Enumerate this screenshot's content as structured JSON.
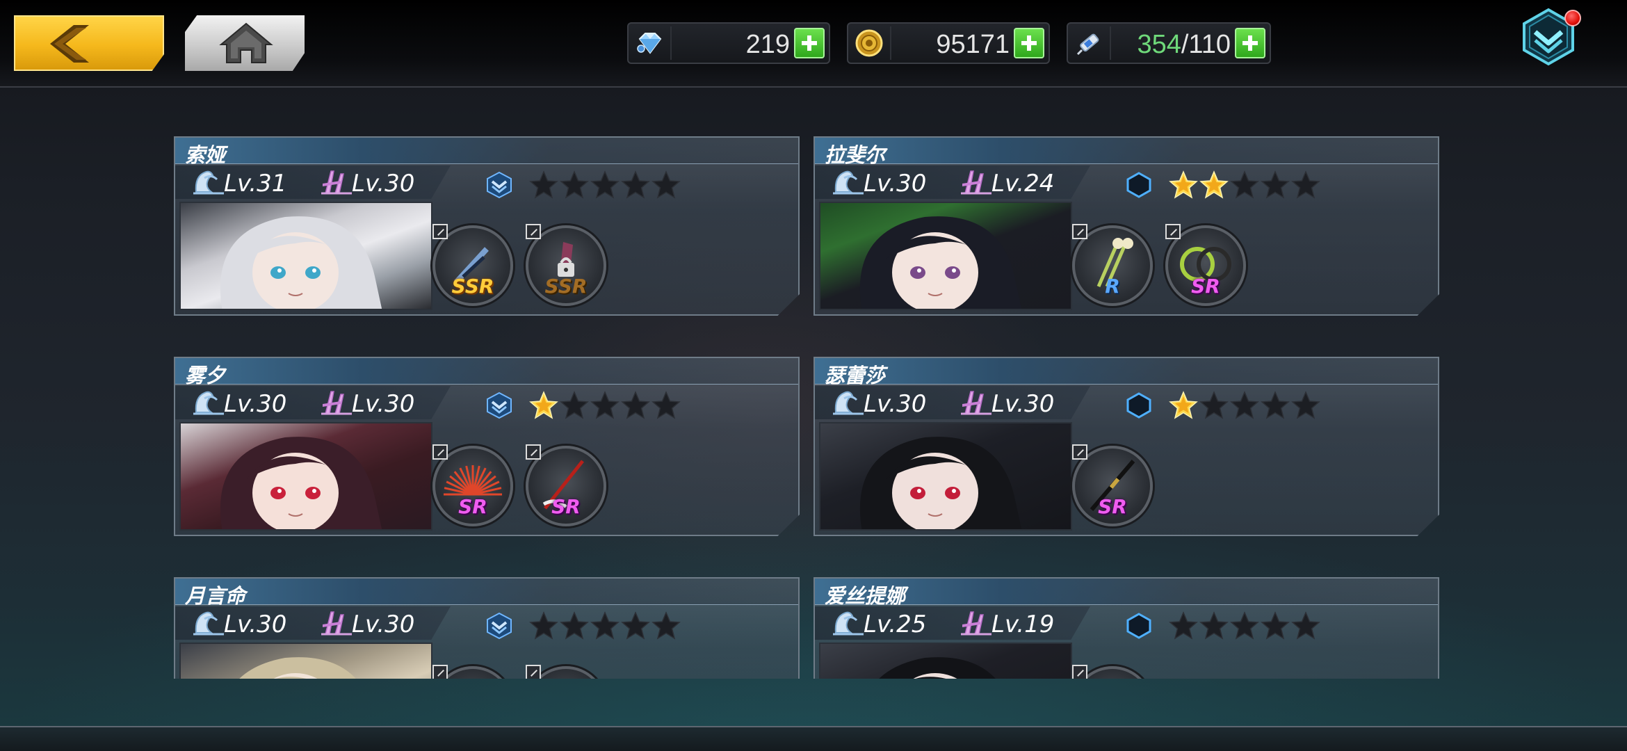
{
  "header": {
    "back_icon": "chevron-left-icon",
    "home_icon": "home-icon",
    "resources": [
      {
        "name": "diamonds",
        "icon": "diamond-icon",
        "value": "219"
      },
      {
        "name": "gold",
        "icon": "gold-coin-icon",
        "value": "95171"
      },
      {
        "name": "stamina",
        "icon": "stamina-syringe-icon",
        "current": "354",
        "max": "/110"
      }
    ],
    "mail_icon": "mission-chevron-icon",
    "notification": true
  },
  "cards": [
    {
      "name": "索娅",
      "lv_char": "v.31",
      "lv_weapon": "v.30",
      "rank_icon": "rank-chevron-icon",
      "stars": 0,
      "weapons": [
        {
          "rarity": "SSR",
          "style": "ssr",
          "locked": false
        },
        {
          "rarity": "SSR",
          "style": "ssr-lock",
          "locked": true
        }
      ]
    },
    {
      "name": "拉斐尔",
      "lv_char": "v.30",
      "lv_weapon": "v.24",
      "rank_icon": "rank-hexagon-icon",
      "stars": 2,
      "weapons": [
        {
          "rarity": "R",
          "style": "r",
          "locked": false
        },
        {
          "rarity": "SR",
          "style": "sr",
          "locked": false
        }
      ]
    },
    {
      "name": "雾夕",
      "lv_char": "v.30",
      "lv_weapon": "v.30",
      "rank_icon": "rank-chevron-icon",
      "stars": 1,
      "weapons": [
        {
          "rarity": "SR",
          "style": "sr",
          "locked": false
        },
        {
          "rarity": "SR",
          "style": "sr",
          "locked": false
        }
      ]
    },
    {
      "name": "瑟蕾莎",
      "lv_char": "v.30",
      "lv_weapon": "v.30",
      "rank_icon": "rank-hexagon-icon",
      "stars": 1,
      "weapons": [
        {
          "rarity": "SR",
          "style": "sr",
          "locked": false
        }
      ]
    },
    {
      "name": "月言命",
      "lv_char": "v.30",
      "lv_weapon": "v.30",
      "rank_icon": "rank-chevron-icon",
      "stars": 0,
      "weapons": []
    },
    {
      "name": "爱丝提娜",
      "lv_char": "v.25",
      "lv_weapon": "v.19",
      "rank_icon": "rank-hexagon-icon",
      "stars": 0,
      "weapons": []
    }
  ],
  "lv_prefix": "L"
}
